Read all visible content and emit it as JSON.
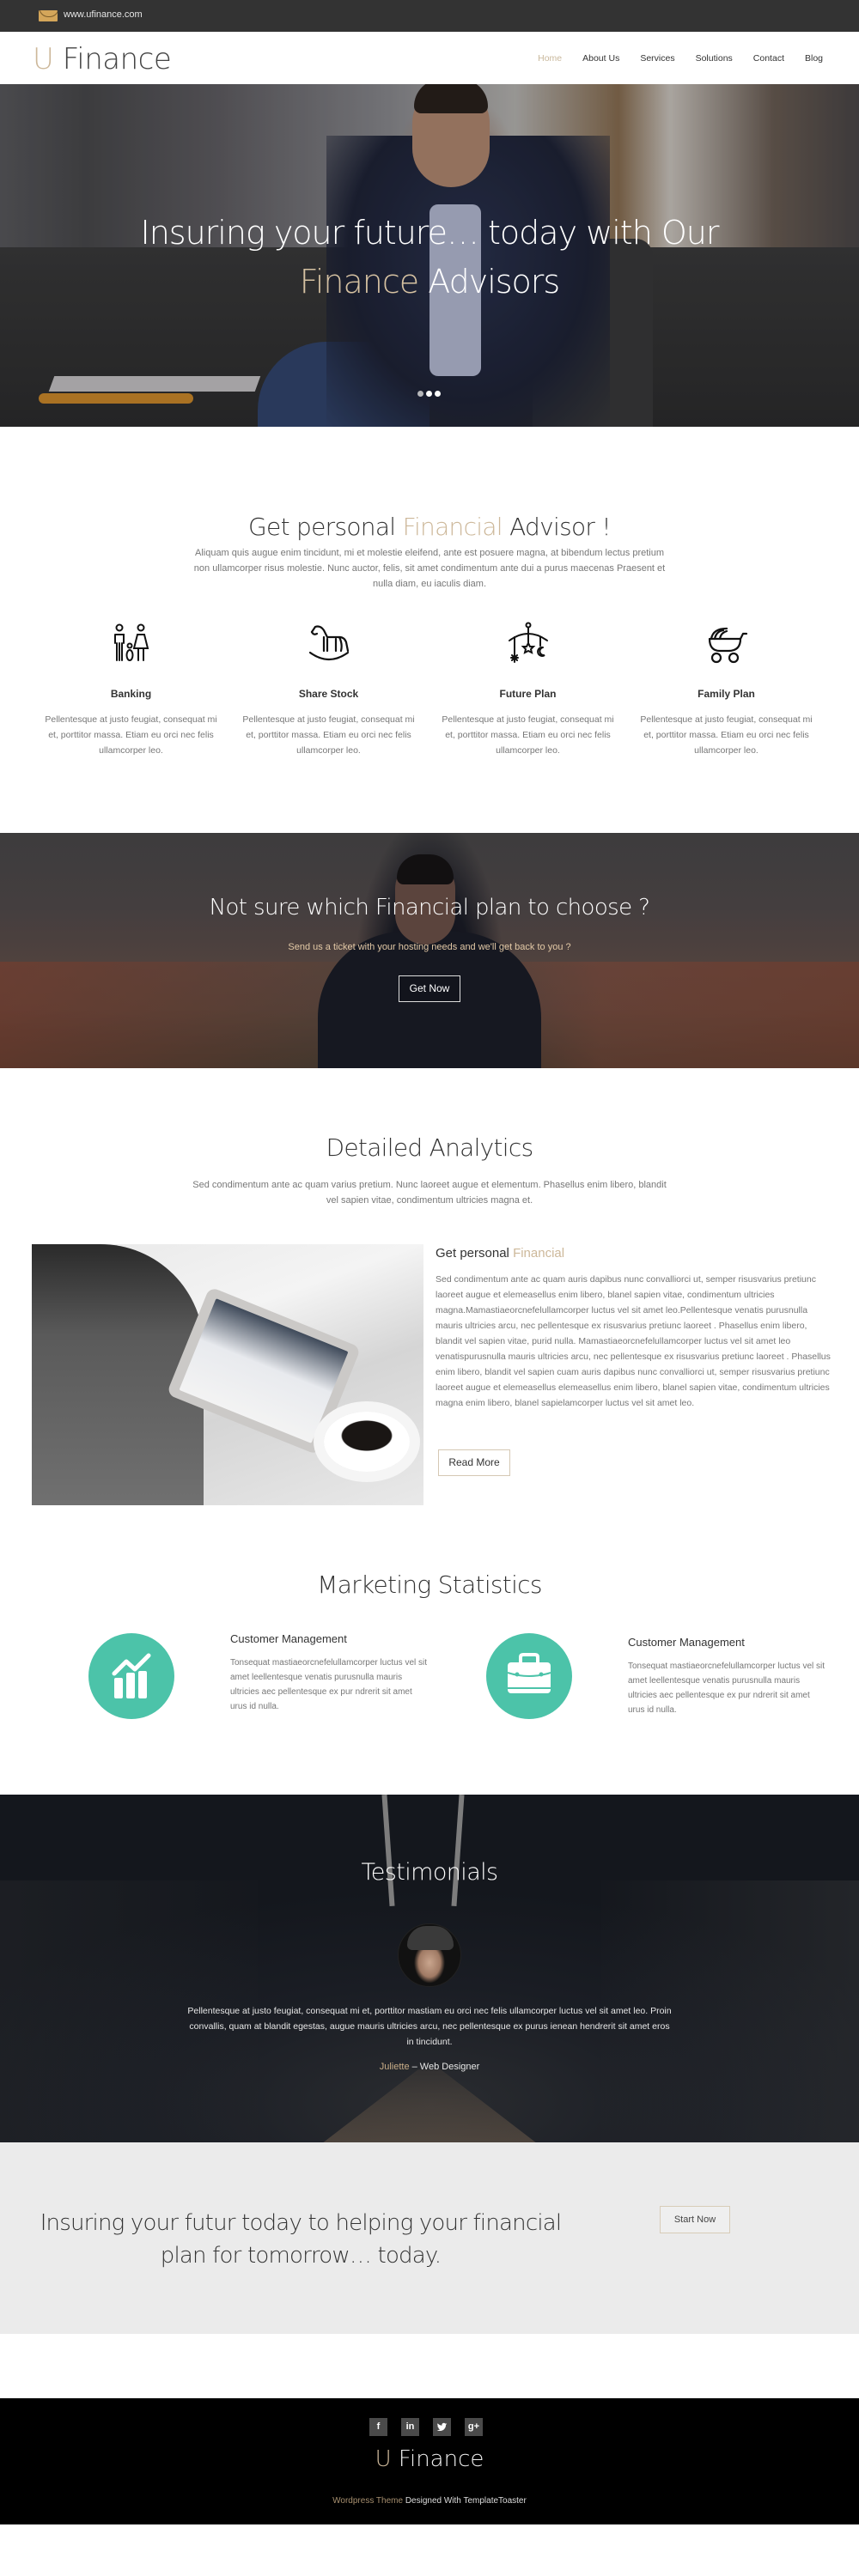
{
  "topbar": {
    "icon": "mail-icon",
    "website": "www.ufinance.com"
  },
  "header": {
    "logo_accent": "U",
    "logo_text": " Finance",
    "nav": [
      {
        "label": "Home",
        "active": true
      },
      {
        "label": "About Us",
        "active": false
      },
      {
        "label": "Services",
        "active": false
      },
      {
        "label": "Solutions",
        "active": false
      },
      {
        "label": "Contact",
        "active": false
      },
      {
        "label": "Blog",
        "active": false
      }
    ]
  },
  "hero": {
    "line1": "Insuring your future… today with Our",
    "line2_accent": "Finance",
    "line2_rest": " Advisors",
    "slides_total": 3,
    "active_slide": 1
  },
  "features": {
    "title_start": "Get personal ",
    "title_accent": "Financial",
    "title_end": " Advisor !",
    "description": "Aliquam quis augue enim tincidunt, mi et molestie eleifend, ante est posuere magna, at bibendum lectus pretium non ullamcorper risus molestie. Nunc auctor, felis, sit amet condimentum ante dui a purus maecenas Praesent et nulla diam, eu iaculis diam.",
    "items": [
      {
        "icon": "family-icon",
        "name": "Banking",
        "text": "Pellentesque at justo feugiat, consequat mi et, porttitor massa. Etiam eu orci nec felis ullamcorper leo."
      },
      {
        "icon": "rocking-horse-icon",
        "name": "Share Stock",
        "text": "Pellentesque at justo feugiat, consequat mi et, porttitor massa. Etiam eu orci nec felis ullamcorper leo."
      },
      {
        "icon": "baby-mobile-icon",
        "name": "Future Plan",
        "text": "Pellentesque at justo feugiat, consequat mi et, porttitor massa. Etiam eu orci nec felis ullamcorper leo."
      },
      {
        "icon": "stroller-icon",
        "name": "Family Plan",
        "text": "Pellentesque at justo feugiat, consequat mi et, porttitor massa. Etiam eu orci nec felis ullamcorper leo."
      }
    ]
  },
  "cta": {
    "title": "Not sure which Financial plan to choose ?",
    "subtitle": "Send us a ticket with your hosting needs and we'll get back to you ?",
    "button": "Get Now"
  },
  "analytics": {
    "title": "Detailed Analytics",
    "description": "Sed condimentum ante ac quam varius pretium. Nunc laoreet augue et elementum. Phasellus enim libero, blandit vel sapien vitae, condimentum ultricies magna et.",
    "heading_start": "Get personal ",
    "heading_accent": "Financial",
    "body": "Sed condimentum ante ac quam auris dapibus nunc convalliorci ut, semper risusvarius pretiunc laoreet augue et elemeasellus enim libero, blanel sapien vitae, condimentum ultricies magna.Mamastiaeorcnefelullamcorper luctus vel sit amet leo.Pellentesque venatis purusnulla mauris ultricies arcu, nec pellentesque ex risusvarius pretiunc laoreet . Phasellus enim libero, blandit vel sapien vitae, purid nulla. Mamastiaeorcnefelullamcorper luctus vel sit amet leo venatispurusnulla mauris ultricies arcu, nec pellentesque ex risusvarius pretiunc laoreet . Phasellus enim libero, blandit vel sapien cuam auris dapibus nunc convalliorci ut, semper risusvarius pretiunc laoreet augue et elemeasellus elemeasellus enim libero, blanel sapien vitae, condimentum ultricies magna enim libero, blanel sapielamcorper luctus vel sit amet leo.",
    "button": "Read More"
  },
  "marketing": {
    "title": "Marketing Statistics",
    "items": [
      {
        "icon": "chart-growth-icon",
        "heading": "Customer Management",
        "text": "Tonsequat mastiaeorcnefelullamcorper luctus vel sit amet leellentesque venatis purusnulla mauris ultricies aec pellentesque ex pur ndrerit sit amet urus id nulla."
      },
      {
        "icon": "briefcase-icon",
        "heading": "Customer Management",
        "text": "Tonsequat mastiaeorcnefelullamcorper luctus vel sit amet leellentesque venatis purusnulla mauris ultricies aec pellentesque ex pur ndrerit sit amet urus id nulla."
      }
    ],
    "accent_color": "#4cc3a9"
  },
  "testimonials": {
    "title": "Testimonials",
    "quote": "Pellentesque at justo feugiat, consequat mi et, porttitor mastiam eu orci nec felis ullamcorper luctus vel sit amet leo. Proin convallis, quam at blandit egestas, augue mauris ultricies arcu, nec pellentesque ex purus ienean hendrerit sit amet eros in tincidunt.",
    "author": "Juliette",
    "role": " – Web Designer"
  },
  "banner": {
    "text": "Insuring your futur today to helping your financial plan for tomorrow… today.",
    "button": "Start Now"
  },
  "footer": {
    "socials": [
      {
        "icon": "facebook-icon",
        "glyph": "f"
      },
      {
        "icon": "linkedin-icon",
        "glyph": "in"
      },
      {
        "icon": "twitter-icon",
        "glyph": "t"
      },
      {
        "icon": "google-plus-icon",
        "glyph": "g+"
      }
    ],
    "logo_accent": "U",
    "logo_text": " Finance",
    "credit_accent": "Wordpress Theme",
    "credit_rest": " Designed With TemplateToaster"
  },
  "colors": {
    "accent": "#cdb89a",
    "topbar": "#333333",
    "teal": "#4cc3a9",
    "banner_bg": "#ebebeb",
    "footer_bg": "#000000"
  }
}
